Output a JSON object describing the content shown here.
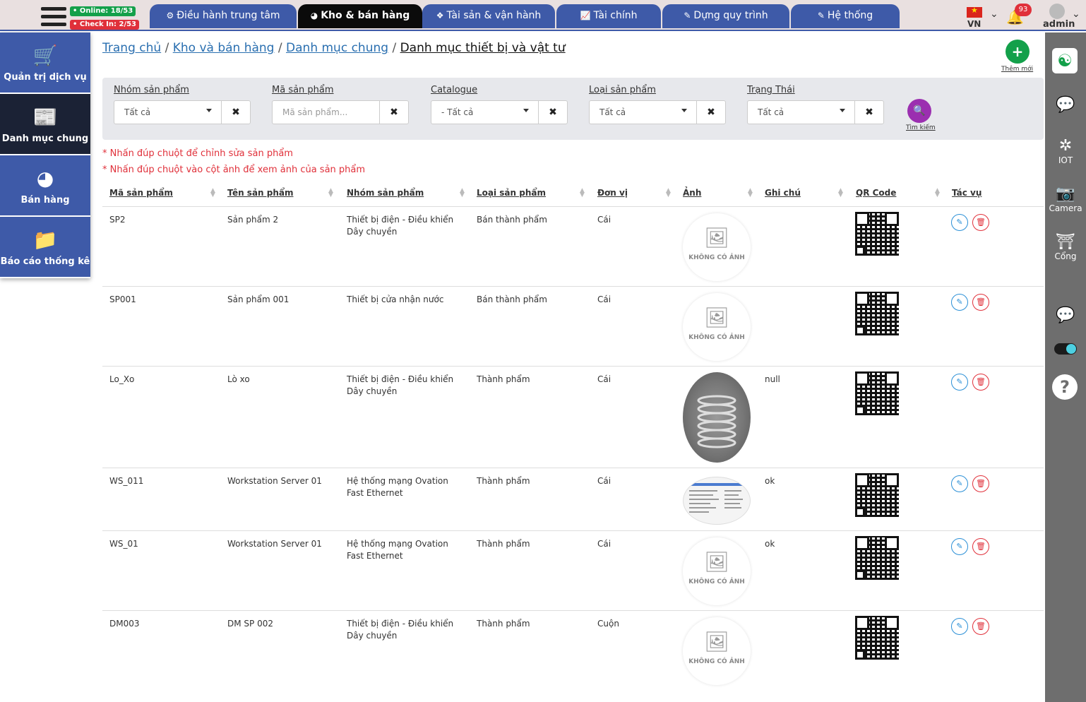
{
  "header": {
    "online": "• Online: 18/53",
    "checkin": "• Check In: 2/53",
    "tabs": [
      {
        "label": "Điều hành trung tâm",
        "icon": "gear-icon"
      },
      {
        "label": "Kho & bán hàng",
        "icon": "pie-chart-icon"
      },
      {
        "label": "Tài sản & vận hành",
        "icon": "cubes-icon"
      },
      {
        "label": "Tài chính",
        "icon": "line-chart-icon"
      },
      {
        "label": "Dựng quy trình",
        "icon": "edit-icon"
      },
      {
        "label": "Hệ thống",
        "icon": "edit-icon"
      }
    ],
    "language": "VN",
    "notifications": "93",
    "username": "admin"
  },
  "leftnav": [
    {
      "label": "Quản trị dịch vụ",
      "icon": "cart-icon"
    },
    {
      "label": "Danh mục chung",
      "icon": "newspaper-icon"
    },
    {
      "label": "Bán hàng",
      "icon": "pie-chart-icon"
    },
    {
      "label": "Báo cáo thống kê",
      "icon": "folder-icon"
    }
  ],
  "rightbar": {
    "iot": "IOT",
    "camera": "Camera",
    "gate": "Cổng",
    "help": "?"
  },
  "breadcrumb": {
    "home": "Trang chủ",
    "section": "Kho và bán hàng",
    "category": "Danh mục chung",
    "current": "Danh mục thiết bị và vật tư",
    "separator": "/"
  },
  "add_new_label": "Thêm mới",
  "filters": {
    "group": {
      "label": "Nhóm sản phẩm",
      "value": "Tất cả"
    },
    "code": {
      "label": "Mã sản phẩm",
      "placeholder": "Mã sản phẩm..."
    },
    "catalogue": {
      "label": "Catalogue",
      "value": "- Tất cả"
    },
    "type": {
      "label": "Loại sản phẩm",
      "value": "Tất cả"
    },
    "status": {
      "label": "Trạng Thái",
      "value": "Tất cả"
    },
    "search_label": "Tìm kiếm"
  },
  "notes": [
    "* Nhấn đúp chuột để chỉnh sửa sản phẩm",
    "* Nhấn đúp chuột vào cột ảnh để xem ảnh của sản phẩm"
  ],
  "table": {
    "columns": [
      "Mã sản phẩm",
      "Tên sản phẩm",
      "Nhóm sản phẩm",
      "Loại sản phẩm",
      "Đơn vị",
      "Ảnh",
      "Ghi chú",
      "QR Code",
      "Tác vụ"
    ],
    "no_image_label": "KHÔNG CÓ ẢNH",
    "rows": [
      {
        "code": "SP2",
        "name": "Sản phẩm 2",
        "group": "Thiết bị điện - Điều khiển Dây chuyền",
        "type": "Bán thành phẩm",
        "unit": "Cái",
        "image": "none",
        "note": ""
      },
      {
        "code": "SP001",
        "name": "Sản phẩm 001",
        "group": "Thiết bị cửa nhận nước",
        "type": "Bán thành phẩm",
        "unit": "Cái",
        "image": "none",
        "note": ""
      },
      {
        "code": "Lo_Xo",
        "name": "Lò xo",
        "group": "Thiết bị điện - Điều khiển Dây chuyền",
        "type": "Thành phẩm",
        "unit": "Cái",
        "image": "spring-photo",
        "note": "null"
      },
      {
        "code": "WS_011",
        "name": "Workstation Server 01",
        "group": "Hệ thống mạng Ovation Fast Ethernet",
        "type": "Thành phẩm",
        "unit": "Cái",
        "image": "screenshot-thumbnail",
        "note": "ok"
      },
      {
        "code": "WS_01",
        "name": "Workstation Server 01",
        "group": "Hệ thống mạng Ovation Fast Ethernet",
        "type": "Thành phẩm",
        "unit": "Cái",
        "image": "none",
        "note": "ok"
      },
      {
        "code": "DM003",
        "name": "DM SP 002",
        "group": "Thiết bị điện - Điều khiển Dây chuyền",
        "type": "Thành phẩm",
        "unit": "Cuộn",
        "image": "none",
        "note": ""
      }
    ]
  }
}
